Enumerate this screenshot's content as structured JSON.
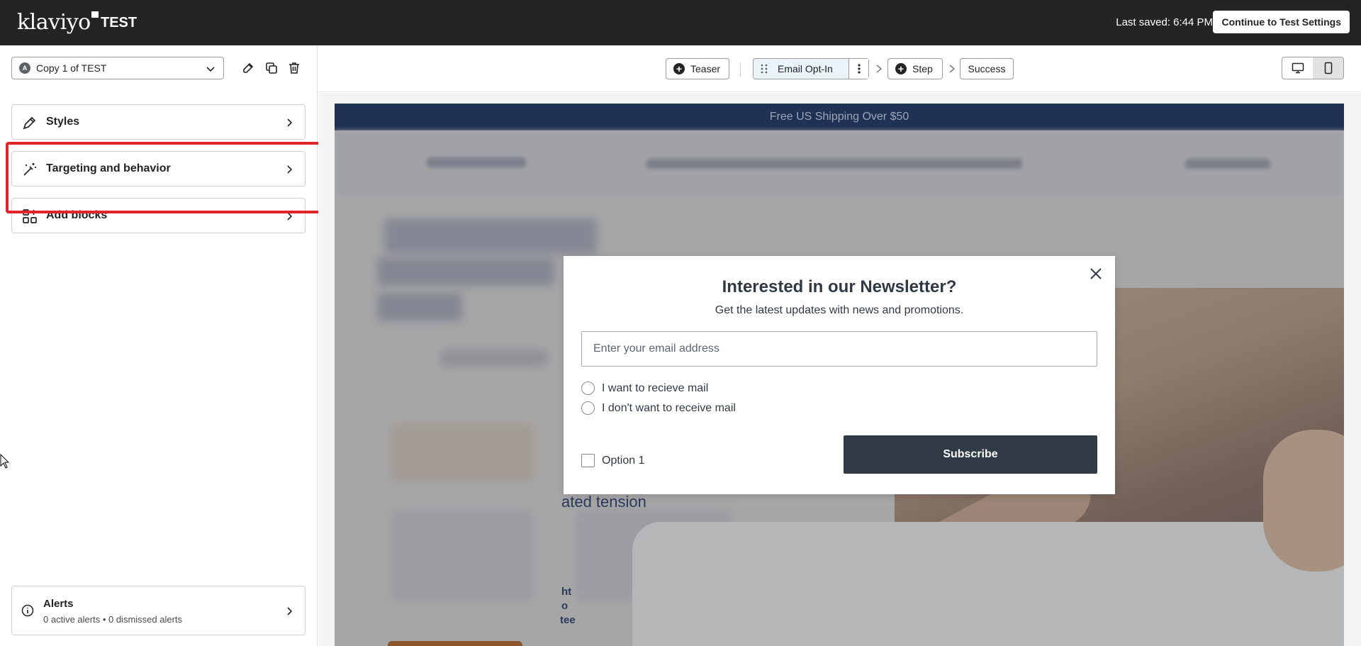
{
  "topbar": {
    "logo_text": "klaviyo",
    "form_name": "TEST",
    "last_saved": "Last saved: 6:44 PM",
    "continue_label": "Continue to Test Settings"
  },
  "sidebar": {
    "variant": {
      "badge": "A",
      "name": "Copy 1 of TEST"
    },
    "tools": [
      "edit-icon",
      "duplicate-icon",
      "trash-icon"
    ],
    "items": [
      {
        "label": "Styles",
        "icon": "brush-icon"
      },
      {
        "label": "Targeting and behavior",
        "icon": "magic-wand-icon"
      },
      {
        "label": "Add blocks",
        "icon": "add-blocks-icon"
      }
    ],
    "alerts": {
      "title": "Alerts",
      "subtitle": "0 active alerts • 0 dismissed alerts"
    },
    "highlight_color": "#e0262b"
  },
  "steps": {
    "teaser": "Teaser",
    "email_opt_in": "Email Opt-In",
    "step": "Step",
    "success": "Success",
    "active": "Email Opt-In"
  },
  "preview": {
    "promo_text": "Free US Shipping Over $50",
    "bg_text": "ated tension",
    "bg_fragments": [
      "ht",
      "o",
      "tee"
    ],
    "modal": {
      "title": "Interested in our Newsletter?",
      "subtitle": "Get the latest updates with news and promotions.",
      "email_placeholder": "Enter your email address",
      "radio_options": [
        "I want to recieve mail",
        "I don't want to receive mail"
      ],
      "checkbox_label": "Option 1",
      "subscribe_label": "Subscribe"
    }
  },
  "colors": {
    "topbar": "#232426",
    "modal_button": "#303a45",
    "promo_bar": "#1d3461",
    "active_step": "#e9f3f8"
  }
}
